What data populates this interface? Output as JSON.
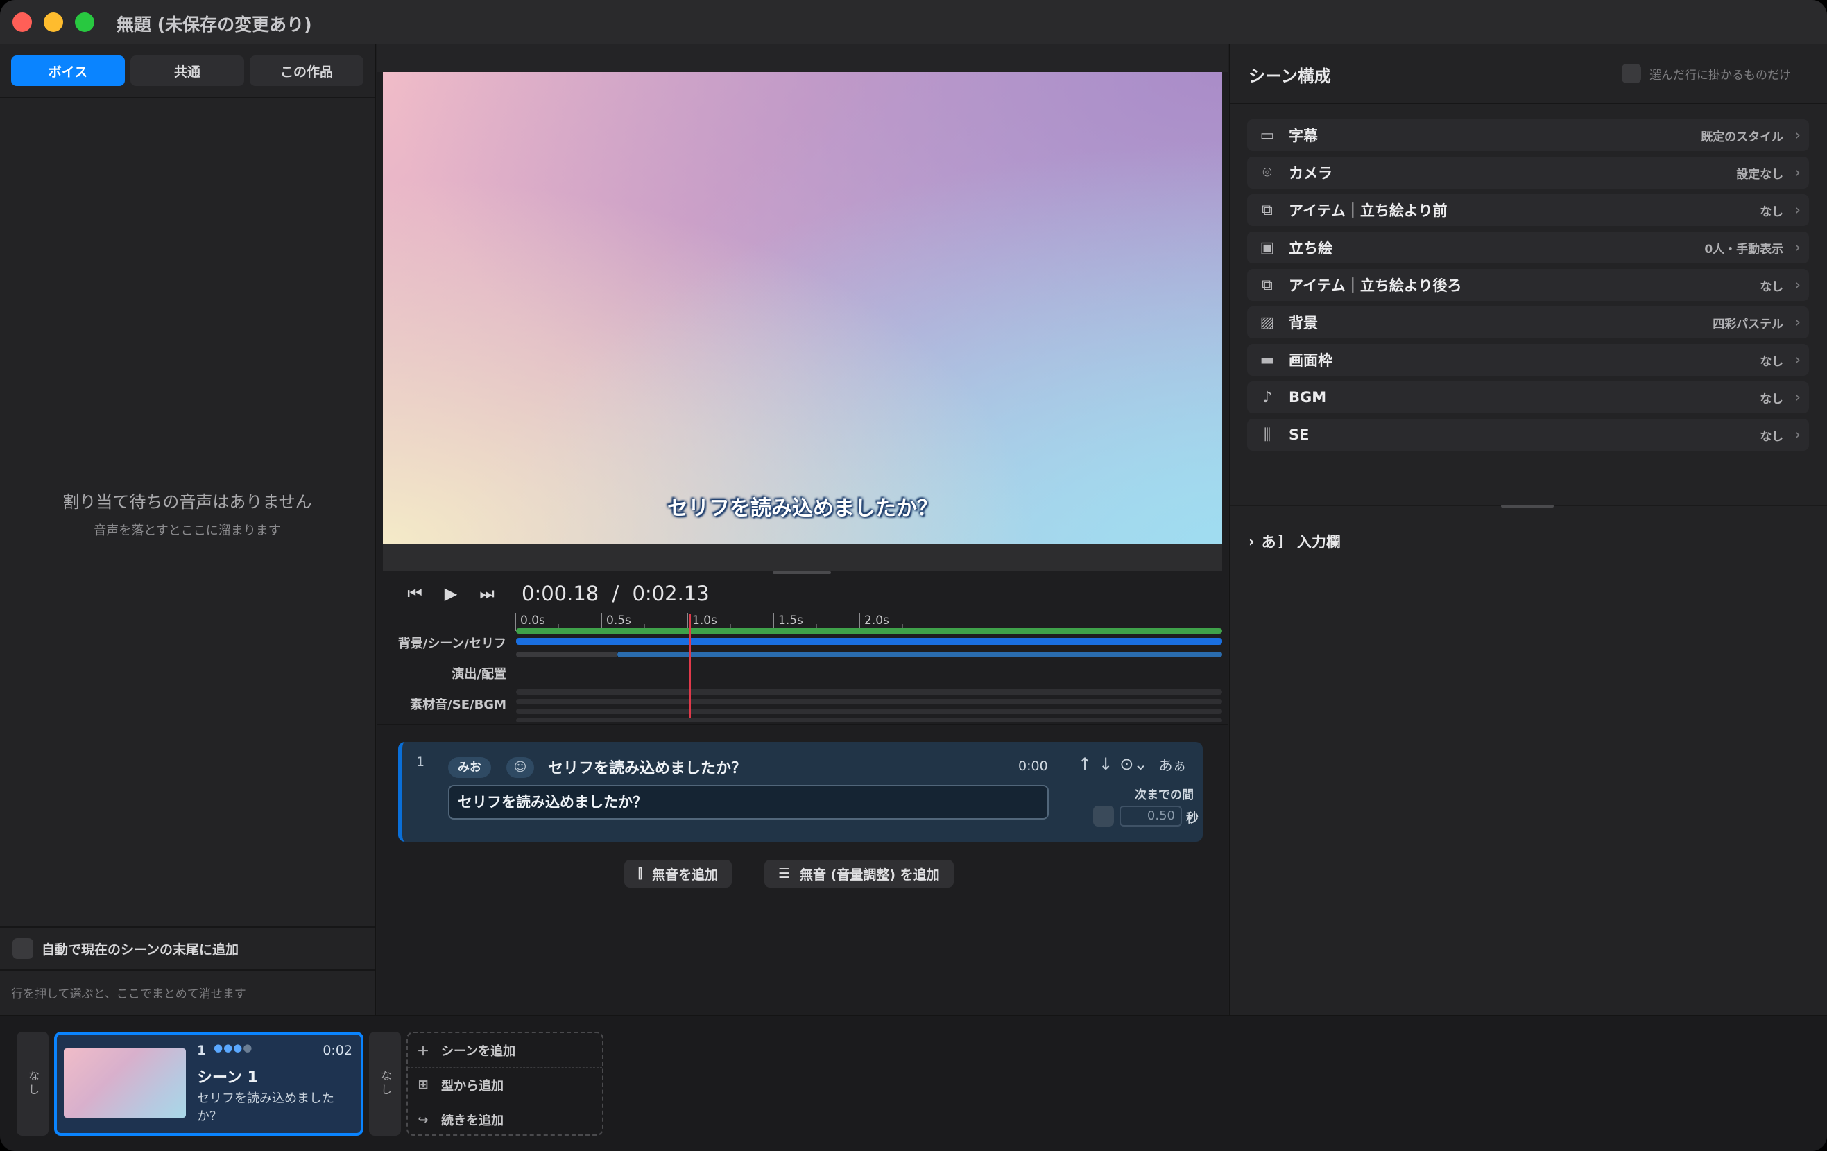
{
  "window": {
    "title": "無題 (未保存の変更あり)"
  },
  "left": {
    "tabs": [
      {
        "label": "ボイス",
        "active": true
      },
      {
        "label": "共通",
        "active": false
      },
      {
        "label": "この作品",
        "active": false
      }
    ],
    "empty_title": "割り当て待ちの音声はありません",
    "empty_subtitle": "音声を落とすとここに溜まります",
    "auto_add_label": "自動で現在のシーンの末尾に追加",
    "hint": "行を押して選ぶと、ここでまとめて消せます"
  },
  "preview": {
    "subtitle": "セリフを読み込めましたか？"
  },
  "transport": {
    "current_time": "0:00.18",
    "separator": "/",
    "total_time": "0:02.13",
    "playhead_sec": 0.18,
    "duration_sec": 2.13
  },
  "timeline": {
    "ticks": [
      "0.0s",
      "0.5s",
      "1.0s",
      "1.5s",
      "2.0s"
    ],
    "tracks": [
      "背景/シーン/セリフ",
      "演出/配置",
      "素材音/SE/BGM"
    ]
  },
  "line": {
    "number": "1",
    "speaker": "みお",
    "text": "セリフを読み込めましたか？",
    "input_value": "セリフを読み込めましたか？",
    "time": "0:00",
    "font_toggle": "あぁ",
    "gap_label": "次までの間",
    "gap_value": "0.50",
    "gap_unit": "秒"
  },
  "actions": {
    "add_silence": "無音を追加",
    "add_silence_volume": "無音 (音量調整) を追加"
  },
  "composition": {
    "title": "シーン構成",
    "filter_label": "選んだ行に掛かるものだけ",
    "rows": [
      {
        "icon": "subtitle-icon",
        "label": "字幕",
        "value": "既定のスタイル"
      },
      {
        "icon": "camera-icon",
        "label": "カメラ",
        "value": "設定なし"
      },
      {
        "icon": "layers-front-icon",
        "label": "アイテム｜立ち絵より前",
        "value": "なし"
      },
      {
        "icon": "portrait-icon",
        "label": "立ち絵",
        "value": "0人・手動表示"
      },
      {
        "icon": "layers-back-icon",
        "label": "アイテム｜立ち絵より後ろ",
        "value": "なし"
      },
      {
        "icon": "image-icon",
        "label": "背景",
        "value": "四彩パステル"
      },
      {
        "icon": "frame-icon",
        "label": "画面枠",
        "value": "なし"
      },
      {
        "icon": "music-note-icon",
        "label": "BGM",
        "value": "なし"
      },
      {
        "icon": "waveform-icon",
        "label": "SE",
        "value": "なし"
      }
    ],
    "input_section_prefix": "あ",
    "input_section_label": "入力欄"
  },
  "scenes": {
    "transition_label": "なし",
    "items": [
      {
        "number": "1",
        "duration": "0:02",
        "name": "シーン 1",
        "desc": "セリフを読み込めましたか？"
      }
    ],
    "add_menu": [
      {
        "icon": "plus-icon",
        "label": "シーンを追加"
      },
      {
        "icon": "grid-icon",
        "label": "型から追加"
      },
      {
        "icon": "continue-arrow-icon",
        "label": "続きを追加"
      }
    ]
  },
  "colors": {
    "accent": "#0a84ff",
    "track_green": "#3fa24a",
    "track_blue": "#1a6fe0",
    "playhead": "#e0394a"
  }
}
